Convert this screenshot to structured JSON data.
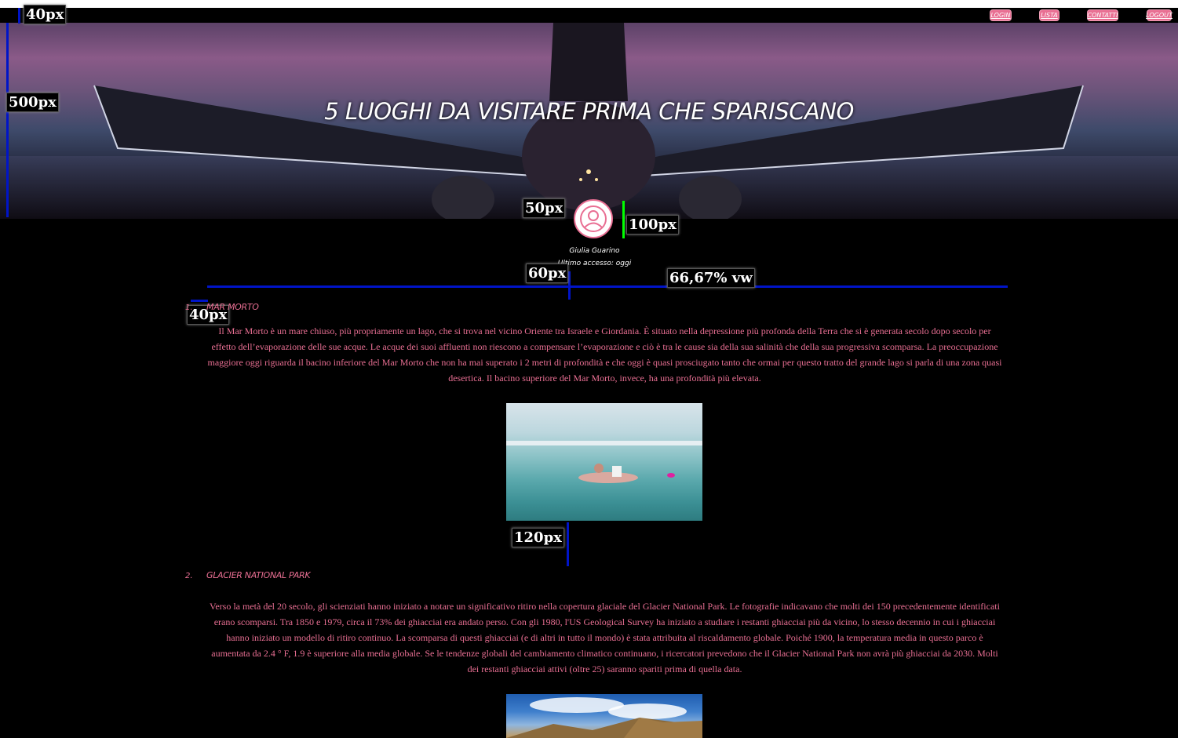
{
  "nav": {
    "items": [
      "LOGIN",
      "LISTA",
      "CONTATTI",
      "LOGOUT"
    ]
  },
  "hero": {
    "title": "5 LUOGHI DA VISITARE PRIMA CHE SPARISCANO"
  },
  "user": {
    "name": "Giulia Guarino",
    "last_access": "Ultimo accesso: oggi"
  },
  "annotations": {
    "a1": "40px",
    "a2": "500px",
    "a3": "50px",
    "a4": "100px",
    "a5": "60px",
    "a6": "66,67% vw",
    "a7": "40px",
    "a8": "120px"
  },
  "sections": [
    {
      "number": "1.",
      "title": "Mar Morto",
      "text": "Il Mar Morto è un mare chiuso, più propriamente un lago, che si trova nel vicino Oriente tra Israele e Giordania. È situato nella depressione più profonda della Terra che si è generata secolo dopo secolo per effetto dell’evaporazione delle sue acque. Le acque dei suoi affluenti non riescono a compensare l’evaporazione e ciò è tra le cause sia della sua salinità che della sua progressiva scomparsa. La preoccupazione maggiore oggi riguarda il bacino inferiore del Mar Morto che non ha mai superato i 2 metri di profondità e che oggi è quasi prosciugato tanto che ormai per questo tratto del grande lago si parla di una zona quasi desertica. Il bacino superiore del Mar Morto, invece, ha una profondità più elevata."
    },
    {
      "number": "2.",
      "title": "Glacier National Park",
      "text": "Verso la metà del 20 secolo, gli scienziati hanno iniziato a notare un significativo ritiro nella copertura glaciale del Glacier National Park. Le fotografie indicavano che molti dei 150 precedentemente identificati erano scomparsi. Tra 1850 e 1979, circa il 73% dei ghiacciai era andato perso. Con gli 1980, l'US Geological Survey ha iniziato a studiare i restanti ghiacciai più da vicino, lo stesso decennio in cui i ghiacciai hanno iniziato un modello di ritiro continuo. La scomparsa di questi ghiacciai (e di altri in tutto il mondo) è stata attribuita al riscaldamento globale. Poiché 1900, la temperatura media in questo parco è aumentata da 2.4 ° F, 1.9 è superiore alla media globale. Se le tendenze globali del cambiamento climatico continuano, i ricercatori prevedono che il Glacier National Park non avrà più ghiacciai da 2030. Molti dei restanti ghiacciai attivi (oltre 25) saranno spariti prima di quella data."
    }
  ]
}
